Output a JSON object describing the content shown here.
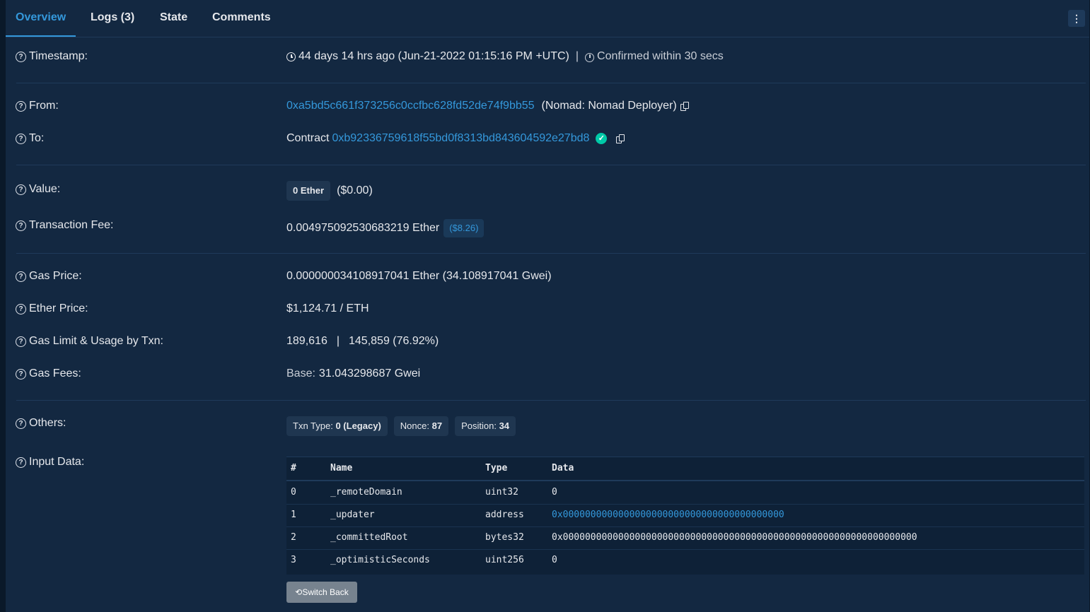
{
  "tabs": [
    {
      "label": "Overview",
      "active": true
    },
    {
      "label": "Logs (3)",
      "active": false
    },
    {
      "label": "State",
      "active": false
    },
    {
      "label": "Comments",
      "active": false
    }
  ],
  "more_menu_glyph": "⋮",
  "timestamp": {
    "label": "Timestamp:",
    "age": "44 days 14 hrs ago (Jun-21-2022 01:15:16 PM +UTC)",
    "separator": "|",
    "confirmed": "Confirmed within 30 secs"
  },
  "from": {
    "label": "From:",
    "address": "0xa5bd5c661f373256c0ccfbc628fd52de74f9bb55",
    "name": "(Nomad: Nomad Deployer)"
  },
  "to": {
    "label": "To:",
    "prefix": "Contract",
    "address": "0xb92336759618f55bd0f8313bd843604592e27bd8"
  },
  "value": {
    "label": "Value:",
    "amount": "0 Ether",
    "usd": "($0.00)"
  },
  "fee": {
    "label": "Transaction Fee:",
    "amount": "0.004975092530683219 Ether",
    "usd": "($8.26)"
  },
  "gas_price": {
    "label": "Gas Price:",
    "value": "0.000000034108917041 Ether (34.108917041 Gwei)"
  },
  "ether_price": {
    "label": "Ether Price:",
    "value": "$1,124.71 / ETH"
  },
  "gas_limit": {
    "label": "Gas Limit & Usage by Txn:",
    "limit": "189,616",
    "separator": "|",
    "usage": "145,859 (76.92%)"
  },
  "gas_fees": {
    "label": "Gas Fees:",
    "base_label": "Base:",
    "base_value": "31.043298687 Gwei"
  },
  "others": {
    "label": "Others:",
    "txn_type_label": "Txn Type:",
    "txn_type_value": "0 (Legacy)",
    "nonce_label": "Nonce:",
    "nonce_value": "87",
    "position_label": "Position:",
    "position_value": "34"
  },
  "input_data": {
    "label": "Input Data:",
    "headers": [
      "#",
      "Name",
      "Type",
      "Data"
    ],
    "rows": [
      {
        "index": "0",
        "name": "_remoteDomain",
        "type": "uint32",
        "data": "0"
      },
      {
        "index": "1",
        "name": "_updater",
        "type": "address",
        "data": "0x0000000000000000000000000000000000000000"
      },
      {
        "index": "2",
        "name": "_committedRoot",
        "type": "bytes32",
        "data": "0x0000000000000000000000000000000000000000000000000000000000000000"
      },
      {
        "index": "3",
        "name": "_optimisticSeconds",
        "type": "uint256",
        "data": "0"
      }
    ],
    "switch_back_label": "Switch Back"
  },
  "colors": {
    "accent": "#3498db",
    "verified": "#00c9a7",
    "panel": "#132841"
  }
}
